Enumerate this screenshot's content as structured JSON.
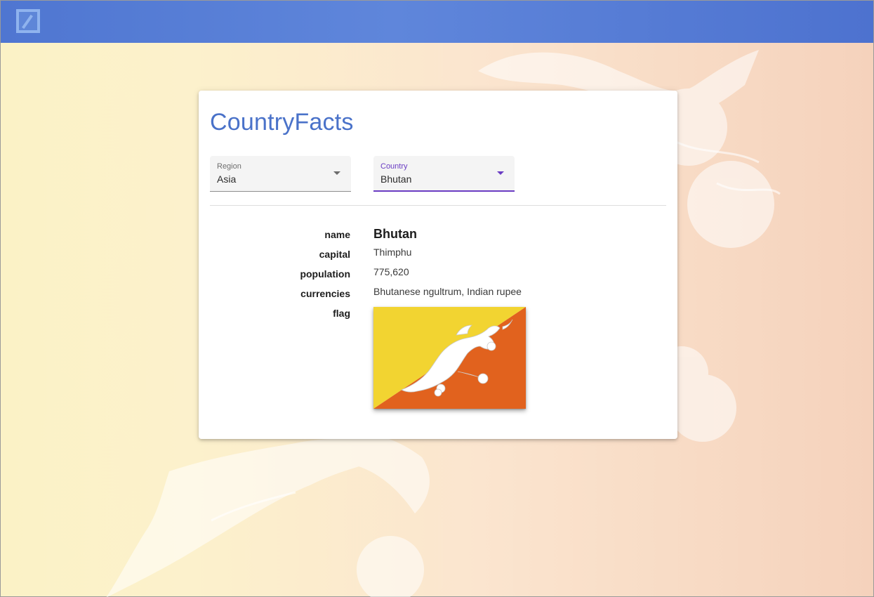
{
  "app": {
    "title": "CountryFacts",
    "logo_icon": "deutsche-bank-logo-icon"
  },
  "filters": {
    "region": {
      "label": "Region",
      "value": "Asia"
    },
    "country": {
      "label": "Country",
      "value": "Bhutan"
    }
  },
  "facts": {
    "labels": {
      "name": "name",
      "capital": "capital",
      "population": "population",
      "currencies": "currencies",
      "flag": "flag"
    },
    "values": {
      "name": "Bhutan",
      "capital": "Thimphu",
      "population": "775,620",
      "currencies": "Bhutanese ngultrum, Indian rupee"
    },
    "flag_colors": {
      "yellow": "#f2d431",
      "orange": "#e1621e",
      "dragon": "#ffffff"
    }
  },
  "colors": {
    "appbar": "#5a80d6",
    "accent": "#4a72c9",
    "focus": "#6a3cc3"
  }
}
